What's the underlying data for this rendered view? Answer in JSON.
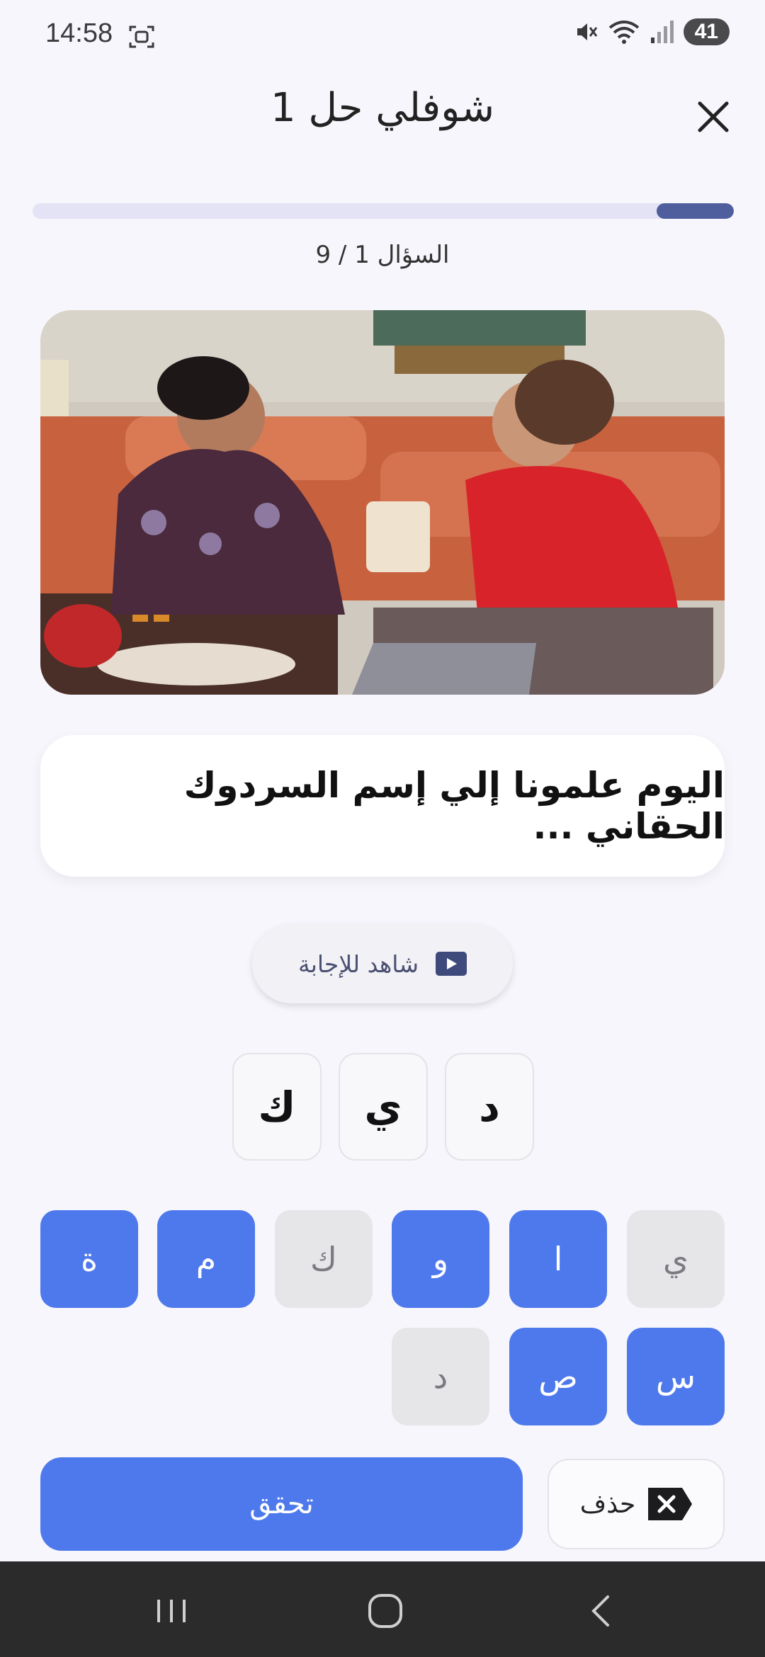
{
  "status_bar": {
    "time": "14:58",
    "battery": "41"
  },
  "header": {
    "title": "شوفلي حل 1"
  },
  "progress": {
    "fraction": 0.11,
    "label": "السؤال 1 / 9"
  },
  "question": {
    "text": "اليوم علمونا إلي إسم السردوك الحقاني ..."
  },
  "watch_answer": {
    "label": "شاهد للإجابة"
  },
  "answer_slots": [
    "د",
    "ي",
    "ك"
  ],
  "keyboard": {
    "row1": [
      {
        "letter": "ي",
        "state": "used"
      },
      {
        "letter": "ا",
        "state": "active"
      },
      {
        "letter": "و",
        "state": "active"
      },
      {
        "letter": "ك",
        "state": "used"
      },
      {
        "letter": "م",
        "state": "active"
      },
      {
        "letter": "ة",
        "state": "active"
      }
    ],
    "row2": [
      {
        "letter": "س",
        "state": "active"
      },
      {
        "letter": "ص",
        "state": "active"
      },
      {
        "letter": "د",
        "state": "used"
      }
    ]
  },
  "actions": {
    "check_label": "تحقق",
    "delete_label": "حذف"
  },
  "colors": {
    "accent": "#4e79ec",
    "progress": "#4f5f9e",
    "background": "#f7f6fc"
  }
}
